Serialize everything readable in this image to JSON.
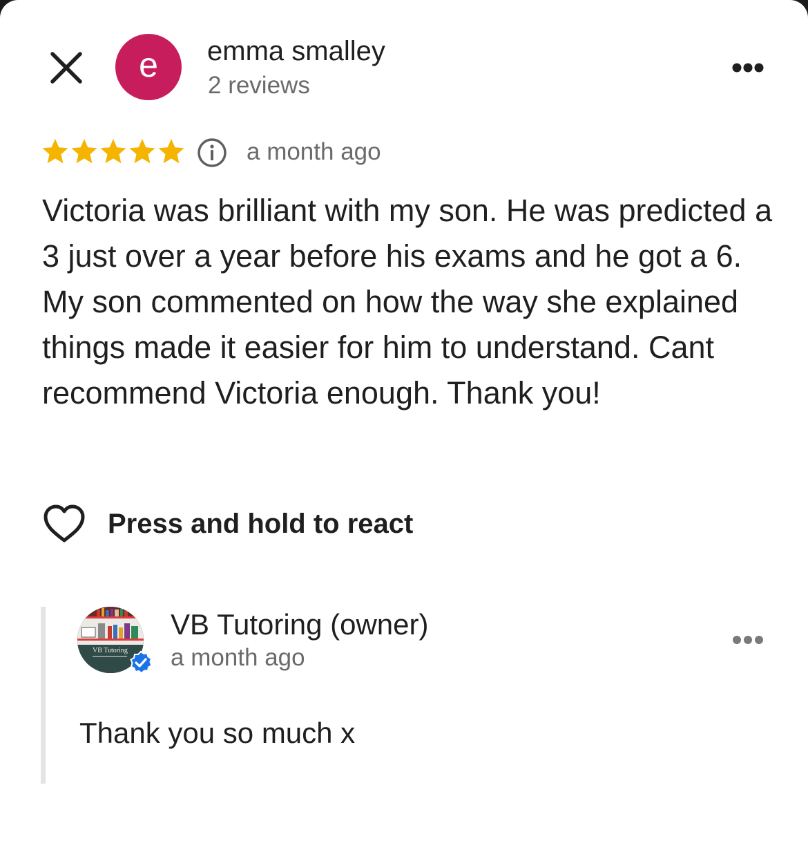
{
  "review": {
    "author_name": "emma smalley",
    "author_reviews": "2 reviews",
    "avatar_letter": "e",
    "avatar_color": "#c81d5c",
    "rating": 5,
    "rating_max": 5,
    "time": "a month ago",
    "text": "Victoria was brilliant with my son. He was predicted a 3 just over a year before his exams and he got a 6. My son commented on how the way she explained things made it easier for him to understand. Cant recommend Victoria enough. Thank you!",
    "react_label": "Press and hold to react"
  },
  "owner_reply": {
    "name": "VB Tutoring (owner)",
    "time": "a month ago",
    "text": "Thank you so much x",
    "avatar_logo_text": "VB Tutoring"
  },
  "icons": {
    "close": "close-icon",
    "more": "more-horizontal-icon",
    "star": "star-icon",
    "info": "info-icon",
    "heart": "heart-icon",
    "verified": "verified-badge-icon"
  },
  "colors": {
    "star": "#f5b400",
    "verified": "#1a73e8",
    "secondary_text": "#6b6b6b"
  }
}
